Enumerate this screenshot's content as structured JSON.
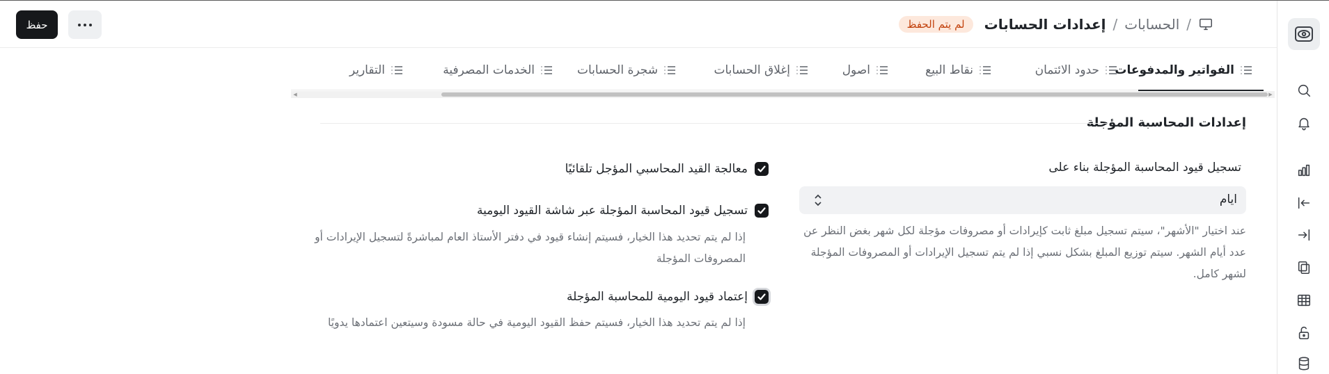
{
  "header": {
    "save_label": "حفظ",
    "more_icon": "more-horizontal-icon",
    "breadcrumb_parent": "الحسابات",
    "breadcrumb_sep": "/",
    "page_title": "إعدادات الحسابات",
    "status_badge": "لم يتم الحفظ",
    "crumb_lead_sep": "/"
  },
  "tabs": [
    {
      "label": "الفواتير والمدفوعات",
      "active": true
    },
    {
      "label": "حدود الائتمان"
    },
    {
      "label": "نقاط البيع"
    },
    {
      "label": "اصول"
    },
    {
      "label": "إغلاق الحسابات"
    },
    {
      "label": "شجرة الحسابات"
    },
    {
      "label": "الخدمات المصرفية"
    },
    {
      "label": "التقارير"
    }
  ],
  "section": {
    "title": "إعدادات المحاسبة المؤجلة"
  },
  "deferred_booking": {
    "label": "تسجيل قيود المحاسبة المؤجلة بناء على",
    "value": "ايام",
    "help": "عند اختيار \"الأشهر\"، سيتم تسجيل مبلغ ثابت كإيرادات أو مصروفات مؤجلة لكل شهر بغض النظر عن عدد أيام الشهر. سيتم توزيع المبلغ بشكل نسبي إذا لم يتم تسجيل الإيرادات أو المصروفات المؤجلة لشهر كامل."
  },
  "checkboxes": [
    {
      "label": "معالجة القيد المحاسبي المؤجل تلقائيًا",
      "checked": true,
      "help": ""
    },
    {
      "label": "تسجيل قيود المحاسبة المؤجلة عبر شاشة القيود اليومية",
      "checked": true,
      "help": "إذا لم يتم تحديد هذا الخيار، فسيتم إنشاء قيود في دفتر الأستاذ العام لمباشرةً لتسجيل الإيرادات أو المصروفات المؤجلة"
    },
    {
      "label": "إعتماد قيود اليومية للمحاسبة المؤجلة",
      "checked": true,
      "help": "إذا لم يتم تحديد هذا الخيار، فسيتم حفظ القيود اليومية في حالة مسودة وسيتعين اعتمادها يدويًا"
    }
  ],
  "sidebar_icons": [
    "app-logo-icon",
    "search-icon",
    "bell-icon",
    "bar-chart-icon",
    "arrow-left-to-line-icon",
    "arrow-right-from-line-icon",
    "documents-icon",
    "table-icon",
    "unlock-icon",
    "database-icon"
  ]
}
